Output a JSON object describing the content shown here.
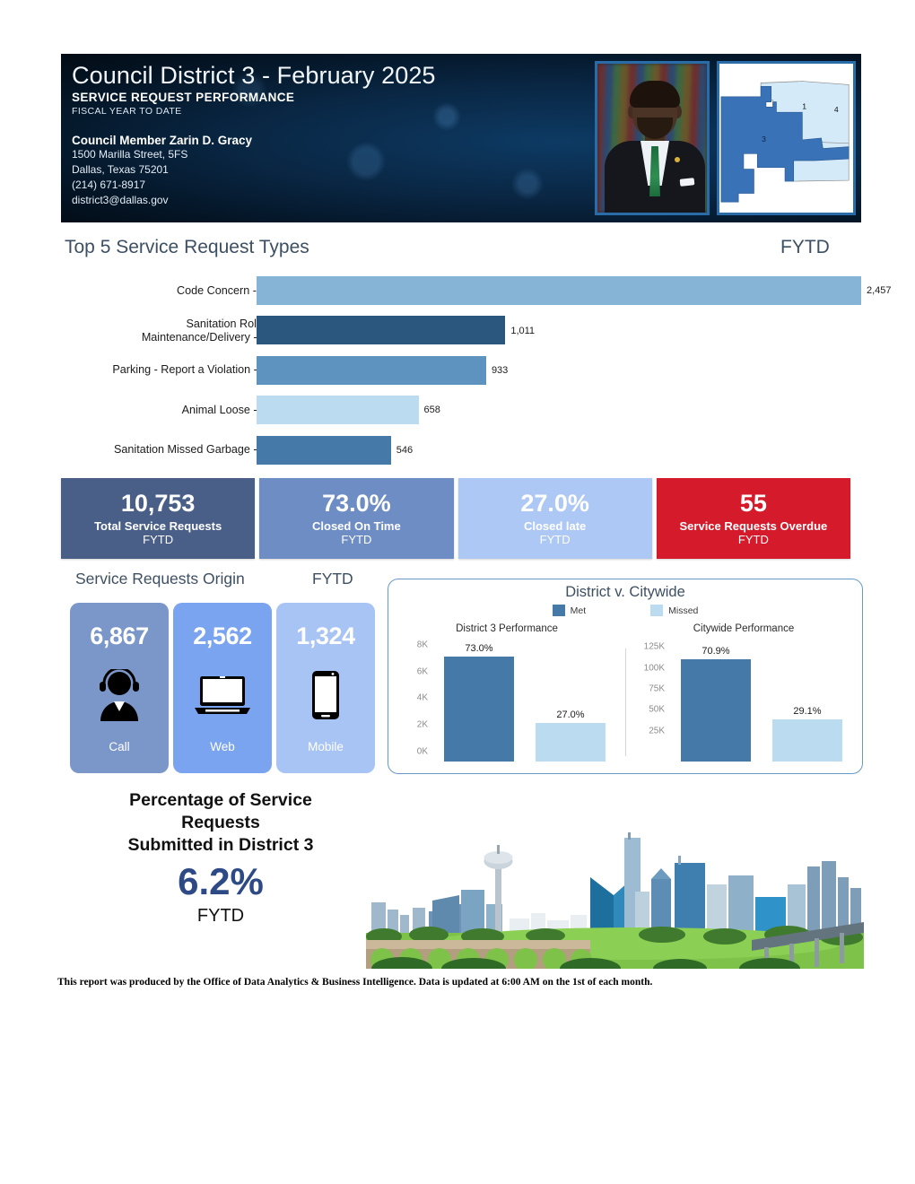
{
  "header": {
    "title": "Council District 3 - February 2025",
    "subtitle": "SERVICE REQUEST PERFORMANCE",
    "period": "FISCAL YEAR TO DATE",
    "member_name": "Council Member Zarin D. Gracy",
    "address_line1": "1500 Marilla Street, 5FS",
    "address_line2": "Dallas, Texas 75201",
    "phone": "(214) 671-8917",
    "email": "district3@dallas.gov",
    "portrait_alt": "council-member-portrait",
    "map_alt": "district-3-map",
    "map_labels": [
      "1",
      "3",
      "4"
    ],
    "bg_color": "#0a2846",
    "accent_border": "#2a6ca8"
  },
  "top5": {
    "title": "Top 5 Service Request Types",
    "fytd_label": "FYTD"
  },
  "kpis": [
    {
      "value": "10,753",
      "line1": "Total Service Requests",
      "line2": "FYTD",
      "color": "#4a5f87"
    },
    {
      "value": "73.0%",
      "line1": "Closed On Time",
      "line2": "FYTD",
      "color": "#6e8dc4"
    },
    {
      "value": "27.0%",
      "line1": "Closed late",
      "line2": "FYTD",
      "color": "#aec8f5"
    },
    {
      "value": "55",
      "line1": "Service Requests Overdue",
      "line2": "FYTD",
      "color": "#d51b2b"
    }
  ],
  "origin": {
    "title": "Service Requests Origin",
    "fytd_label": "FYTD",
    "cards": [
      {
        "value": "6,867",
        "label": "Call",
        "icon": "headset-person-icon",
        "color": "#7b96c8"
      },
      {
        "value": "2,562",
        "label": "Web",
        "icon": "laptop-icon",
        "color": "#7ba4f0"
      },
      {
        "value": "1,324",
        "label": "Mobile",
        "icon": "mobile-phone-icon",
        "color": "#a8c4f5"
      }
    ]
  },
  "percentage": {
    "heading_line1": "Percentage of Service",
    "heading_line2": "Requests",
    "heading_line3": "Submitted in District 3",
    "value": "6.2%",
    "footer": "FYTD",
    "value_color": "#2e4a86"
  },
  "skyline_alt": "dallas-skyline-photo",
  "footer_note": "This report was produced by the Office of Data Analytics & Business Intelligence. Data is updated at 6:00 AM on the 1st of each month.",
  "chart_data": [
    {
      "type": "bar",
      "orientation": "horizontal",
      "title": "Top 5 Service Request Types",
      "subtitle": "FYTD",
      "categories": [
        "Code Concern - CCS",
        "Sanitation Roll Cart Maintenance/Delivery - SAN",
        "Parking - Report a Violation - TRN",
        "Animal Loose - DAS",
        "Sanitation Missed Garbage - SAN"
      ],
      "values": [
        2457,
        1011,
        933,
        658,
        546
      ],
      "value_labels": [
        "2,457",
        "1,011",
        "933",
        "658",
        "546"
      ],
      "colors": [
        "#85b4d6",
        "#2b577f",
        "#5e93c0",
        "#bbdcf0",
        "#4579a8"
      ],
      "xlabel": "",
      "ylabel": "",
      "xlim": [
        0,
        2457
      ],
      "grid": false,
      "legend": "none"
    },
    {
      "type": "bar",
      "title": "District v. Citywide",
      "legend": [
        "Met",
        "Missed"
      ],
      "legend_colors": [
        "#4579a8",
        "#bbdcf0"
      ],
      "legend_position": "top",
      "panels": [
        {
          "title": "District 3 Performance",
          "ticks": [
            "0K",
            "2K",
            "4K",
            "6K",
            "8K"
          ],
          "tick_values": [
            0,
            2000,
            4000,
            6000,
            8000
          ],
          "ylim": [
            0,
            8600
          ],
          "categories": [
            "Met",
            "Missed"
          ],
          "values": [
            7848,
            2905
          ],
          "data_labels": [
            "73.0%",
            "27.0%"
          ]
        },
        {
          "title": "Citywide Performance",
          "ticks": [
            "25K",
            "50K",
            "75K",
            "100K",
            "125K"
          ],
          "tick_values": [
            25000,
            50000,
            75000,
            100000,
            125000
          ],
          "ylim": [
            0,
            137000
          ],
          "categories": [
            "Met",
            "Missed"
          ],
          "values": [
            122000,
            50000
          ],
          "data_labels": [
            "70.9%",
            "29.1%"
          ]
        }
      ]
    }
  ]
}
